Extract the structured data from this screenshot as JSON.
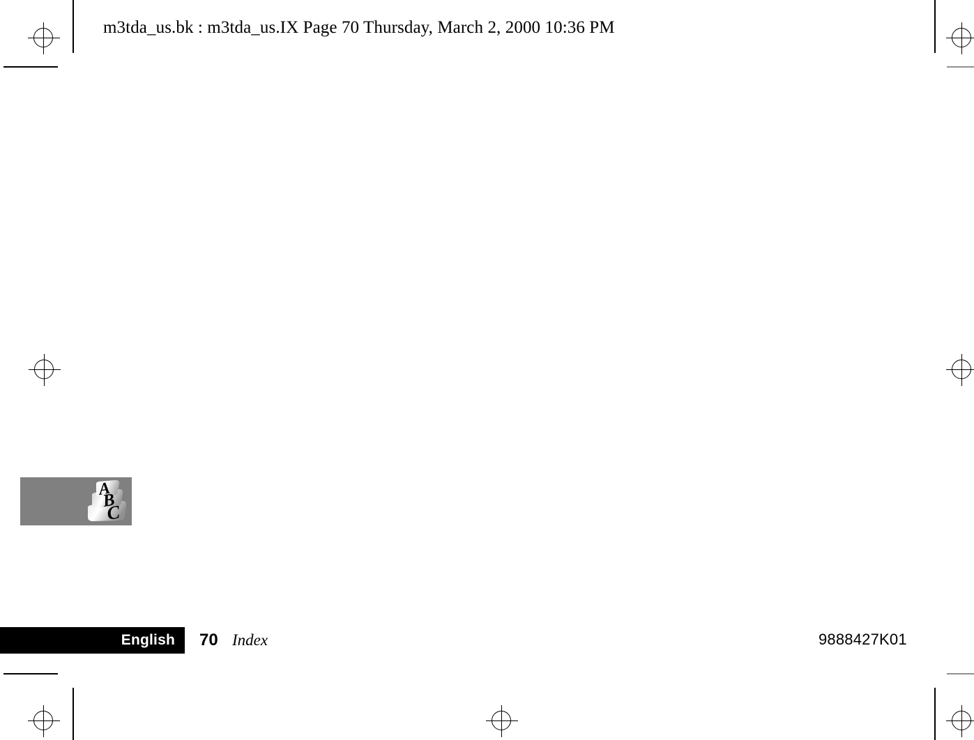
{
  "document": {
    "header_stamp": "m3tda_us.bk : m3tda_us.IX  Page 70  Thursday, March 2, 2000  10:36 PM",
    "source_file": "m3tda_us.bk",
    "output_file": "m3tda_us.IX",
    "page_label": "Page 70",
    "timestamp": "Thursday, March 2, 2000  10:36 PM"
  },
  "logo": {
    "alt": "ABC logo",
    "letters": [
      "A",
      "B",
      "C"
    ],
    "box_color": "#808080",
    "letter_color": "#000000",
    "banner_color": "#ffffff"
  },
  "footer": {
    "language": "English",
    "page_number": "70",
    "section": "Index",
    "part_number": "9888427K01",
    "bar_color": "#000000",
    "bar_text_color": "#ffffff"
  },
  "marks": {
    "registration_label": "registration mark",
    "trim_label": "trim line"
  },
  "body": {
    "content": ""
  }
}
